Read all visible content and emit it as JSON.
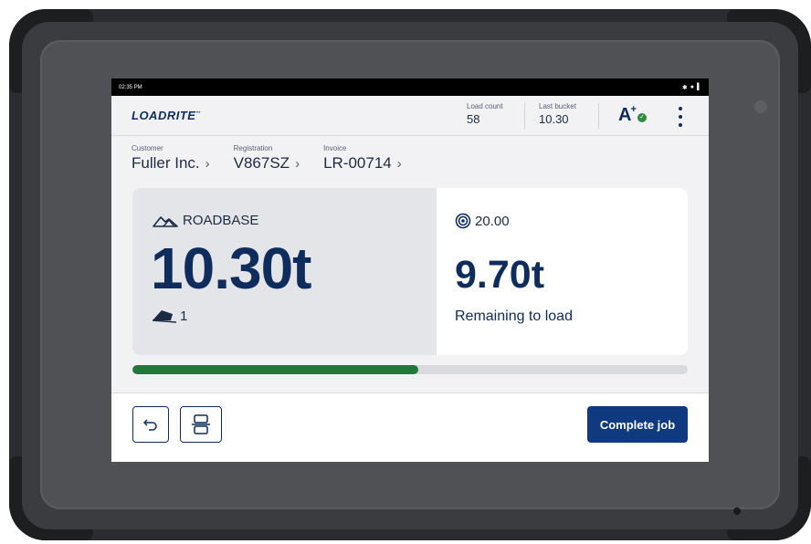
{
  "status_bar": {
    "time": "02:35 PM"
  },
  "app": {
    "logo": "LOADRITE",
    "load_count": {
      "label": "Load count",
      "value": "58"
    },
    "last_bucket": {
      "label": "Last bucket",
      "value": "10.30"
    },
    "grade": {
      "letter": "A",
      "modifier": "+"
    }
  },
  "info": [
    {
      "label": "Customer",
      "value": "Fuller Inc."
    },
    {
      "label": "Registration",
      "value": "V867SZ"
    },
    {
      "label": "Invoice",
      "value": "LR-00714"
    }
  ],
  "load": {
    "material": "ROADBASE",
    "weight": "10.30t",
    "bucket_count": "1"
  },
  "target": {
    "value": "20.00",
    "remaining": "9.70t",
    "remaining_label": "Remaining to load"
  },
  "progress": {
    "fraction": 0.515,
    "fill_color": "#22773a"
  },
  "actions": {
    "complete_label": "Complete job"
  },
  "colors": {
    "brand_navy": "#0f2d5c",
    "primary_button": "#0f3a80"
  },
  "icons": [
    "undo-icon",
    "layout-icon",
    "kebab-menu-icon",
    "material-pile-icon",
    "bucket-icon",
    "target-icon",
    "bluetooth-icon",
    "wifi-icon",
    "signal-icon",
    "check-circle-icon"
  ]
}
